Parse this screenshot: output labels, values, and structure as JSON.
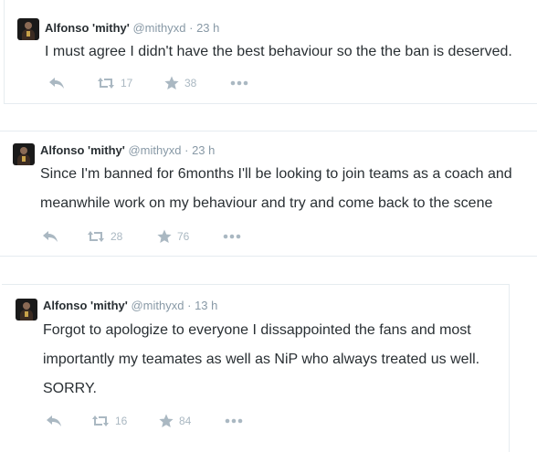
{
  "tweets": [
    {
      "name": "Alfonso 'mithy'",
      "handle": "@mithyxd",
      "separator": "·",
      "time": "23 h",
      "lines": [
        "I must agree I didn't have the best behaviour so the the ban is deserved."
      ],
      "retweets": "17",
      "likes": "38"
    },
    {
      "name": "Alfonso 'mithy'",
      "handle": "@mithyxd",
      "separator": "·",
      "time": "23 h",
      "lines": [
        "Since I'm banned for 6months I'll be looking to join teams as a coach and",
        "meanwhile work on my behaviour and try and come back to the scene"
      ],
      "retweets": "28",
      "likes": "76"
    },
    {
      "name": "Alfonso 'mithy'",
      "handle": "@mithyxd",
      "separator": "·",
      "time": "13 h",
      "lines": [
        "Forgot to apologize to everyone I dissappointed the fans and most",
        "importantly my teamates as well as NiP who always treated us well.",
        "SORRY."
      ],
      "retweets": "16",
      "likes": "84"
    }
  ],
  "icons": {
    "reply": "reply-icon",
    "retweet": "retweet-icon",
    "like": "star-icon",
    "more": "more-icon"
  },
  "colors": {
    "text": "#292f33",
    "secondary": "#8899a6",
    "action": "#aab8c2",
    "divider": "#e6ecf0"
  }
}
